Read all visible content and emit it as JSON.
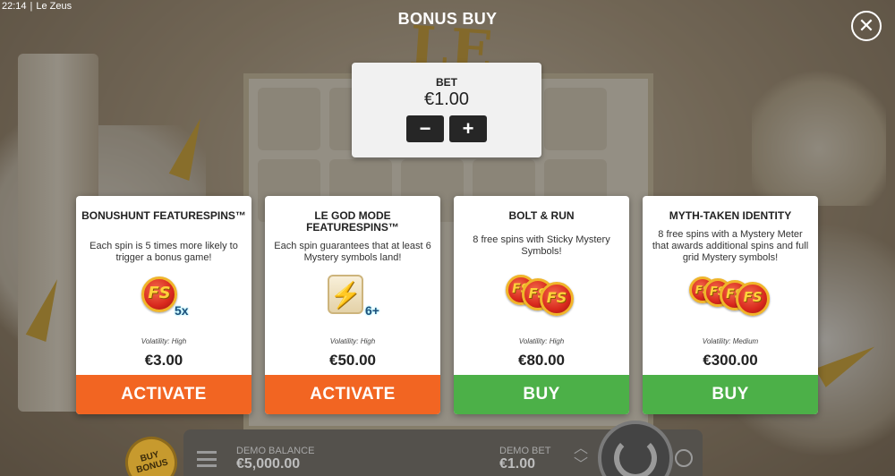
{
  "status_bar": {
    "time": "22:14",
    "separator": "|",
    "app_name": "Le Zeus"
  },
  "modal": {
    "title": "BONUS BUY",
    "close_icon": "close-icon"
  },
  "bet": {
    "label": "BET",
    "amount": "€1.00",
    "decrease": "−",
    "increase": "+"
  },
  "cards": [
    {
      "title": "BONUSHUNT FEATURESPINS™",
      "description": "Each spin is 5 times more likely to trigger a bonus game!",
      "icon": "fs-coin-icon",
      "badge": "5x",
      "volatility": "Volatility: High",
      "price": "€3.00",
      "action": "ACTIVATE",
      "action_color": "#f26522"
    },
    {
      "title": "LE GOD MODE FEATURESPINS™",
      "description": "Each spin guarantees that at least 6 Mystery symbols land!",
      "icon": "mystery-scroll-icon",
      "badge": "6+",
      "volatility": "Volatility: High",
      "price": "€50.00",
      "action": "ACTIVATE",
      "action_color": "#f26522"
    },
    {
      "title": "BOLT & RUN",
      "description": "8 free spins with Sticky Mystery Symbols!",
      "icon": "fs-coins-3-icon",
      "volatility": "Volatility: High",
      "price": "€80.00",
      "action": "BUY",
      "action_color": "#4cb048"
    },
    {
      "title": "MYTH-TAKEN IDENTITY",
      "description": "8 free spins with a Mystery Meter that awards additional spins and full grid Mystery symbols!",
      "icon": "fs-coins-4-icon",
      "volatility": "Volatility: Medium",
      "price": "€300.00",
      "action": "BUY",
      "action_color": "#4cb048"
    }
  ],
  "game": {
    "logo_text": "LE ZEUS",
    "buy_bonus_badge": "BUY BONUS",
    "demo_balance_label": "DEMO BALANCE",
    "demo_balance_value": "€5,000.00",
    "demo_bet_label": "DEMO BET",
    "demo_bet_value": "€1.00"
  }
}
